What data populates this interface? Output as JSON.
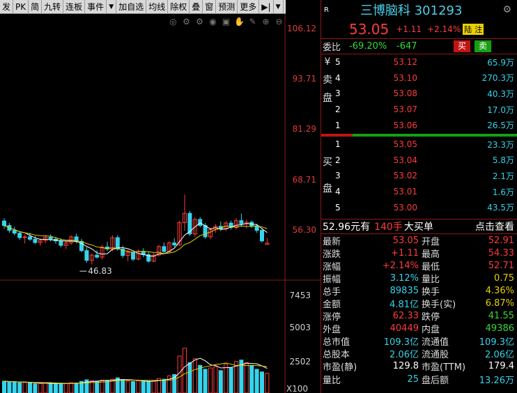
{
  "toolbar": {
    "items": [
      "发",
      "PK",
      "简",
      "九转",
      "连板",
      "事件",
      "▼",
      "加自选",
      "均线",
      "除权",
      "叠",
      "窗",
      "预测",
      "更多",
      "▶|",
      "▼"
    ]
  },
  "chart": {
    "price_ticks": [
      "106.12",
      "93.71",
      "81.29",
      "68.71",
      "56.30"
    ],
    "low_marker": "46.83",
    "volume_ticks": [
      "7453",
      "5003",
      "2502"
    ],
    "volume_unit": "X100",
    "colors": {
      "up": "#ff3b3b",
      "down": "#35d4ec",
      "ma5": "#ffffff",
      "ma10": "#e7d000",
      "axis": "#8b1a1a"
    }
  },
  "chart_data": {
    "type": "candlestick",
    "price_axis": [
      46.83,
      106.12
    ],
    "candles": [
      {
        "o": 58.5,
        "h": 59.2,
        "l": 56.6,
        "c": 57.4
      },
      {
        "o": 57.4,
        "h": 58.0,
        "l": 55.6,
        "c": 56.2
      },
      {
        "o": 56.2,
        "h": 57.1,
        "l": 54.9,
        "c": 55.5
      },
      {
        "o": 55.5,
        "h": 56.0,
        "l": 53.8,
        "c": 54.4
      },
      {
        "o": 54.4,
        "h": 55.2,
        "l": 53.0,
        "c": 54.6
      },
      {
        "o": 54.6,
        "h": 55.6,
        "l": 53.6,
        "c": 54.0
      },
      {
        "o": 54.0,
        "h": 54.8,
        "l": 52.8,
        "c": 53.2
      },
      {
        "o": 53.2,
        "h": 54.2,
        "l": 52.4,
        "c": 53.7
      },
      {
        "o": 53.7,
        "h": 55.0,
        "l": 53.0,
        "c": 54.5
      },
      {
        "o": 54.5,
        "h": 55.2,
        "l": 53.5,
        "c": 54.0
      },
      {
        "o": 54.0,
        "h": 54.6,
        "l": 52.9,
        "c": 53.6
      },
      {
        "o": 53.6,
        "h": 54.2,
        "l": 52.0,
        "c": 52.5
      },
      {
        "o": 52.5,
        "h": 53.6,
        "l": 51.6,
        "c": 53.1
      },
      {
        "o": 53.1,
        "h": 55.0,
        "l": 52.6,
        "c": 54.6
      },
      {
        "o": 54.6,
        "h": 55.4,
        "l": 53.0,
        "c": 53.5
      },
      {
        "o": 53.5,
        "h": 54.1,
        "l": 50.8,
        "c": 51.2
      },
      {
        "o": 51.2,
        "h": 52.0,
        "l": 48.2,
        "c": 48.8
      },
      {
        "o": 48.8,
        "h": 50.5,
        "l": 47.8,
        "c": 50.1
      },
      {
        "o": 50.1,
        "h": 51.3,
        "l": 49.2,
        "c": 49.6
      },
      {
        "o": 49.6,
        "h": 52.6,
        "l": 49.0,
        "c": 52.1
      },
      {
        "o": 52.1,
        "h": 53.4,
        "l": 51.1,
        "c": 51.6
      },
      {
        "o": 51.6,
        "h": 55.0,
        "l": 51.0,
        "c": 54.4
      },
      {
        "o": 54.4,
        "h": 55.0,
        "l": 51.2,
        "c": 51.6
      },
      {
        "o": 51.6,
        "h": 52.4,
        "l": 49.4,
        "c": 50.0
      },
      {
        "o": 50.0,
        "h": 51.4,
        "l": 48.6,
        "c": 50.8
      },
      {
        "o": 50.8,
        "h": 51.0,
        "l": 48.6,
        "c": 49.1
      },
      {
        "o": 49.1,
        "h": 51.5,
        "l": 48.8,
        "c": 51.0
      },
      {
        "o": 51.0,
        "h": 51.8,
        "l": 49.6,
        "c": 50.2
      },
      {
        "o": 50.2,
        "h": 50.8,
        "l": 48.2,
        "c": 48.6
      },
      {
        "o": 48.6,
        "h": 50.6,
        "l": 48.3,
        "c": 50.1
      },
      {
        "o": 50.1,
        "h": 52.6,
        "l": 49.8,
        "c": 52.2
      },
      {
        "o": 52.2,
        "h": 53.2,
        "l": 50.6,
        "c": 51.0
      },
      {
        "o": 51.0,
        "h": 53.6,
        "l": 50.6,
        "c": 53.1
      },
      {
        "o": 53.1,
        "h": 54.3,
        "l": 52.1,
        "c": 52.6
      },
      {
        "o": 52.6,
        "h": 58.6,
        "l": 52.4,
        "c": 58.1
      },
      {
        "o": 58.1,
        "h": 65.0,
        "l": 56.1,
        "c": 60.4
      },
      {
        "o": 60.4,
        "h": 61.0,
        "l": 54.8,
        "c": 55.3
      },
      {
        "o": 55.3,
        "h": 59.5,
        "l": 54.6,
        "c": 58.9
      },
      {
        "o": 58.9,
        "h": 59.5,
        "l": 56.9,
        "c": 57.4
      },
      {
        "o": 57.4,
        "h": 58.0,
        "l": 54.1,
        "c": 54.6
      },
      {
        "o": 54.6,
        "h": 56.9,
        "l": 54.0,
        "c": 56.4
      },
      {
        "o": 56.4,
        "h": 57.8,
        "l": 55.6,
        "c": 57.2
      },
      {
        "o": 57.2,
        "h": 58.4,
        "l": 56.0,
        "c": 56.6
      },
      {
        "o": 56.6,
        "h": 58.5,
        "l": 56.0,
        "c": 58.0
      },
      {
        "o": 58.0,
        "h": 58.6,
        "l": 56.4,
        "c": 56.9
      },
      {
        "o": 56.9,
        "h": 59.2,
        "l": 56.4,
        "c": 58.6
      },
      {
        "o": 58.6,
        "h": 60.3,
        "l": 57.2,
        "c": 57.8
      },
      {
        "o": 57.8,
        "h": 58.8,
        "l": 56.7,
        "c": 58.2
      },
      {
        "o": 58.2,
        "h": 58.6,
        "l": 56.8,
        "c": 57.3
      },
      {
        "o": 57.3,
        "h": 57.8,
        "l": 55.6,
        "c": 56.2
      },
      {
        "o": 56.2,
        "h": 56.8,
        "l": 53.2,
        "c": 53.6
      },
      {
        "o": 52.7,
        "h": 54.3,
        "l": 52.7,
        "c": 53.05
      }
    ],
    "volumes": [
      900,
      850,
      820,
      780,
      800,
      760,
      700,
      720,
      760,
      740,
      700,
      690,
      710,
      780,
      760,
      880,
      1000,
      940,
      900,
      980,
      960,
      1050,
      1150,
      980,
      900,
      870,
      920,
      880,
      870,
      930,
      1100,
      1050,
      1300,
      1400,
      2800,
      3400,
      2300,
      2600,
      2100,
      1800,
      1900,
      2000,
      1700,
      2200,
      1900,
      2400,
      2500,
      2300,
      2100,
      1800,
      1600,
      1500
    ]
  },
  "right": {
    "flag": "R",
    "title": "三博脑科 301293",
    "price": "53.05",
    "change": "+1.11",
    "pct": "+2.14%",
    "lu_tag": "陆",
    "tong_tag": "注",
    "wb_label": "委比",
    "wb_pct": "-69.20%",
    "wb_diff": "-647",
    "buy_btn": "买",
    "sell_btn": "卖",
    "sell_side": [
      "¥",
      "卖",
      "盘"
    ],
    "buy_side": [
      "买",
      "盘"
    ],
    "asks": [
      {
        "n": "5",
        "p": "53.12",
        "v": "65.9万"
      },
      {
        "n": "4",
        "p": "53.10",
        "v": "270.3万"
      },
      {
        "n": "3",
        "p": "53.08",
        "v": "40.3万"
      },
      {
        "n": "2",
        "p": "53.07",
        "v": "17.0万"
      },
      {
        "n": "1",
        "p": "53.06",
        "v": "26.5万"
      }
    ],
    "bids": [
      {
        "n": "1",
        "p": "53.05",
        "v": "23.3万"
      },
      {
        "n": "2",
        "p": "53.04",
        "v": "5.8万"
      },
      {
        "n": "3",
        "p": "53.02",
        "v": "2.1万"
      },
      {
        "n": "4",
        "p": "53.01",
        "v": "1.6万"
      },
      {
        "n": "5",
        "p": "53.00",
        "v": "43.5万"
      }
    ],
    "last_trade": {
      "price": "52.96元有",
      "qty": "140手",
      "label": "大买单",
      "link": "点击查看"
    },
    "stats": [
      {
        "k": "最新",
        "v": "53.05",
        "vc": "red",
        "k2": "开盘",
        "v2": "52.91",
        "v2c": "red"
      },
      {
        "k": "涨跌",
        "v": "+1.11",
        "vc": "red",
        "k2": "最高",
        "v2": "54.33",
        "v2c": "red"
      },
      {
        "k": "涨幅",
        "v": "+2.14%",
        "vc": "red",
        "k2": "最低",
        "v2": "52.71",
        "v2c": "red"
      },
      {
        "k": "振幅",
        "v": "3.12%",
        "vc": "cyan",
        "k2": "量比",
        "v2": "0.75",
        "v2c": "yel"
      },
      {
        "k": "总手",
        "v": "89835",
        "vc": "cyan",
        "k2": "换手",
        "v2": "4.36%",
        "v2c": "yel"
      },
      {
        "k": "金额",
        "v": "4.81亿",
        "vc": "cyan",
        "k2": "换手(实)",
        "v2": "6.87%",
        "v2c": "yel"
      },
      {
        "k": "涨停",
        "v": "62.33",
        "vc": "red",
        "k2": "跌停",
        "v2": "41.55",
        "v2c": "green"
      },
      {
        "k": "外盘",
        "v": "40449",
        "vc": "red",
        "k2": "内盘",
        "v2": "49386",
        "v2c": "green"
      },
      {
        "k": "总市值",
        "v": "109.3亿",
        "vc": "cyan",
        "k2": "流通值",
        "v2": "109.3亿",
        "v2c": "cyan"
      },
      {
        "k": "总股本",
        "v": "2.06亿",
        "vc": "cyan",
        "k2": "流通股",
        "v2": "2.06亿",
        "v2c": "cyan"
      },
      {
        "k": "市盈(静)",
        "v": "129.8",
        "vc": "wht",
        "k2": "市盈(TTM)",
        "v2": "179.4",
        "v2c": "wht"
      },
      {
        "k": "量比",
        "v": "25",
        "vc": "cyan",
        "k2": "盘后额",
        "v2": "13.26万",
        "v2c": "cyan"
      }
    ]
  }
}
